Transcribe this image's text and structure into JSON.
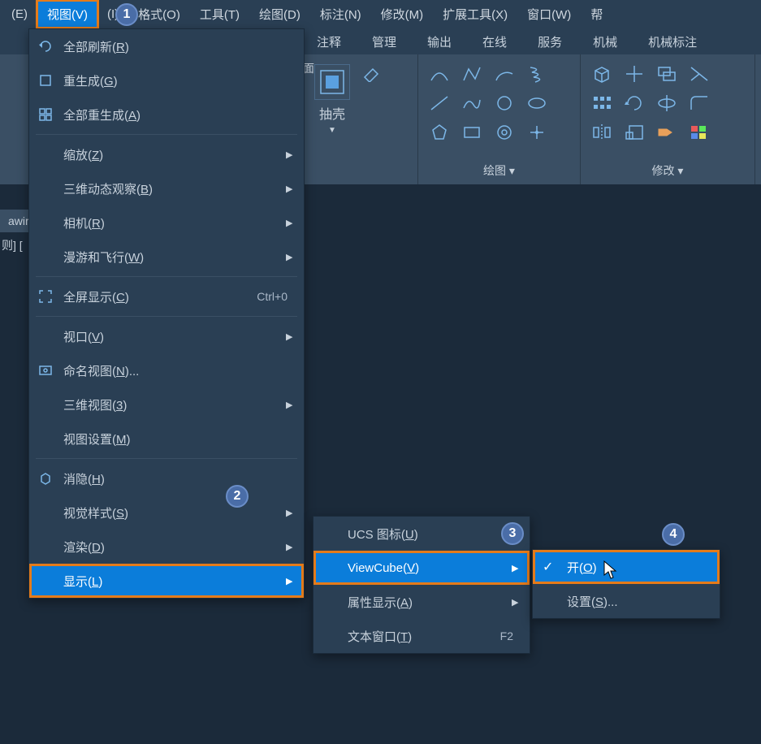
{
  "menubar": {
    "items": [
      {
        "label": "(E)"
      },
      {
        "label": "视图(V)"
      },
      {
        "label": "(I)"
      },
      {
        "label": "格式(O)"
      },
      {
        "label": "工具(T)"
      },
      {
        "label": "绘图(D)"
      },
      {
        "label": "标注(N)"
      },
      {
        "label": "修改(M)"
      },
      {
        "label": "扩展工具(X)"
      },
      {
        "label": "窗口(W)"
      },
      {
        "label": "帮"
      }
    ]
  },
  "ribbon_tabs": [
    "注释",
    "管理",
    "输出",
    "在线",
    "服务",
    "机械",
    "机械标注"
  ],
  "ribbon_panels": {
    "panel1": {
      "btn_label": "抽壳",
      "footer": "面"
    },
    "panel2": {
      "footer": "绘图 ▾"
    },
    "panel3": {
      "footer": "修改 ▾"
    }
  },
  "doc_tab": "awir",
  "bracket": "则] [",
  "view_menu": {
    "items": [
      {
        "icon": "refresh-icon",
        "label": "全部刷新(R)",
        "u": "R"
      },
      {
        "icon": "regen-icon",
        "label": "重生成(G)",
        "u": "G"
      },
      {
        "icon": "regen-all-icon",
        "label": "全部重生成(A)",
        "u": "A"
      },
      {
        "sep": true
      },
      {
        "label": "缩放(Z)",
        "u": "Z",
        "sub": true
      },
      {
        "label": "三维动态观察(B)",
        "u": "B",
        "sub": true
      },
      {
        "label": "相机(R)",
        "u": "R",
        "sub": true
      },
      {
        "label": "漫游和飞行(W)",
        "u": "W",
        "sub": true
      },
      {
        "sep": true
      },
      {
        "icon": "fullscreen-icon",
        "label": "全屏显示(C)",
        "u": "C",
        "shortcut": "Ctrl+0"
      },
      {
        "sep": true
      },
      {
        "label": "视口(V)",
        "u": "V",
        "sub": true
      },
      {
        "icon": "named-view-icon",
        "label": "命名视图(N)...",
        "u": "N"
      },
      {
        "label": "三维视图(3)",
        "u": "3",
        "sub": true
      },
      {
        "label": "视图设置(M)",
        "u": "M"
      },
      {
        "sep": true
      },
      {
        "icon": "hide-icon",
        "label": "消隐(H)",
        "u": "H"
      },
      {
        "label": "视觉样式(S)",
        "u": "S",
        "sub": true
      },
      {
        "label": "渲染(D)",
        "u": "D",
        "sub": true
      },
      {
        "label": "显示(L)",
        "u": "L",
        "sub": true,
        "highlighted": true
      }
    ]
  },
  "display_menu": {
    "items": [
      {
        "label": "UCS 图标(U)",
        "u": "U",
        "sub": true
      },
      {
        "label": "ViewCube(V)",
        "u": "V",
        "sub": true,
        "highlighted": true
      },
      {
        "label": "属性显示(A)",
        "u": "A",
        "sub": true
      },
      {
        "label": "文本窗口(T)",
        "u": "T",
        "shortcut": "F2"
      }
    ]
  },
  "viewcube_menu": {
    "items": [
      {
        "label": "开(O)",
        "u": "O",
        "check": true,
        "highlighted": true
      },
      {
        "label": "设置(S)...",
        "u": "S"
      }
    ]
  },
  "steps": {
    "s1": "1",
    "s2": "2",
    "s3": "3",
    "s4": "4"
  }
}
